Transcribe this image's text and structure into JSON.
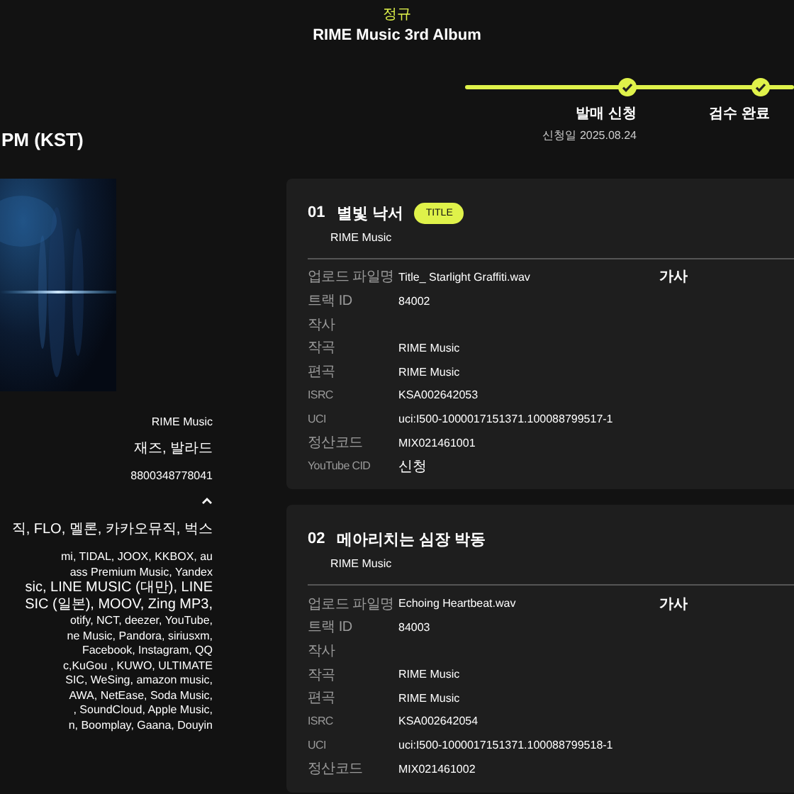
{
  "header": {
    "type_label": "정규",
    "title": "RIME Music 3rd Album"
  },
  "release_time": "PM (KST)",
  "steps": [
    {
      "label": "발매 신청",
      "date": "신청일 2025.08.24",
      "done": true
    },
    {
      "label": "검수 완료",
      "done": true
    }
  ],
  "album": {
    "cover": {
      "kind": "picture"
    },
    "info": [
      "RIME Music",
      "재즈, 발라드",
      "8800348778041"
    ],
    "expanded": true,
    "platforms_domestic": [
      "직, FLO, 멜론, 카카오뮤직, 벅스"
    ],
    "platforms_overseas": [
      "mi, TIDAL, JOOX, KKBOX, au",
      "ass Premium Music, Yandex",
      "sic, LINE MUSIC (대만), LINE",
      "SIC (일본), MOOV, Zing MP3,",
      "otify, NCT, deezer, YouTube,",
      "ne Music, Pandora, siriusxm,",
      "Facebook, Instagram, QQ",
      "c,KuGou , KUWO, ULTIMATE",
      "SIC, WeSing, amazon music,",
      "AWA, NetEase, Soda Music,",
      ", SoundCloud, Apple Music,",
      "n, Boomplay, Gaana, Douyin"
    ]
  },
  "tracks": [
    {
      "number": "01",
      "title": "별빛 낙서",
      "badge": "TITLE",
      "artist": "RIME Music",
      "lyrics_label": "가사",
      "fields": [
        {
          "label": "업로드 파일명",
          "value": "Title_ Starlight Graffiti.wav"
        },
        {
          "label": "트랙 ID",
          "value": "84002"
        },
        {
          "label": "작사"
        },
        {
          "label": "작곡",
          "value": "RIME Music"
        },
        {
          "label": "편곡",
          "value": "RIME Music"
        },
        {
          "label": "ISRC",
          "value": "KSA002642053"
        },
        {
          "label": "UCI",
          "value": "uci:I500-1000017151371.100088799517-1"
        },
        {
          "label": "정산코드",
          "value": "MIX021461001"
        },
        {
          "label": "YouTube CID",
          "value": "신청"
        }
      ]
    },
    {
      "number": "02",
      "title": "메아리치는 심장 박동",
      "artist": "RIME Music",
      "lyrics_label": "가사",
      "fields": [
        {
          "label": "업로드 파일명",
          "value": "Echoing Heartbeat.wav"
        },
        {
          "label": "트랙 ID",
          "value": "84003"
        },
        {
          "label": "작사"
        },
        {
          "label": "작곡",
          "value": "RIME Music"
        },
        {
          "label": "편곡",
          "value": "RIME Music"
        },
        {
          "label": "ISRC",
          "value": "KSA002642054"
        },
        {
          "label": "UCI",
          "value": "uci:I500-1000017151371.100088799518-1"
        },
        {
          "label": "정산코드",
          "value": "MIX021461002"
        }
      ]
    }
  ]
}
